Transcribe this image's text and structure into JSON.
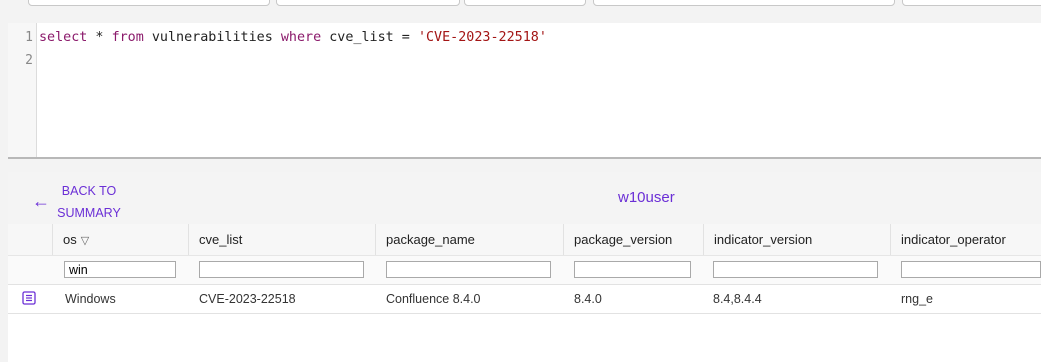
{
  "editor": {
    "line_numbers": [
      "1",
      "2"
    ],
    "code": {
      "t1": "select",
      "t2": " * ",
      "t3": "from",
      "t4": " vulnerabilities ",
      "t5": "where",
      "t6": " cve_list = ",
      "t7": "'CVE-2023-22518'"
    }
  },
  "results": {
    "back_label_line1": "BACK TO",
    "back_label_line2": "SUMMARY",
    "title": "w10user",
    "columns": [
      "os",
      "cve_list",
      "package_name",
      "package_version",
      "indicator_version",
      "indicator_operator"
    ],
    "filters": [
      "win",
      "",
      "",
      "",
      "",
      ""
    ],
    "rows": [
      [
        "Windows",
        "CVE-2023-22518",
        "Confluence 8.4.0",
        "8.4.0",
        "8.4,8.4.4",
        "rng_e"
      ]
    ]
  },
  "colors": {
    "accent": "#6b2fd6",
    "keyword": "#8b1a6b",
    "string": "#a31515"
  }
}
